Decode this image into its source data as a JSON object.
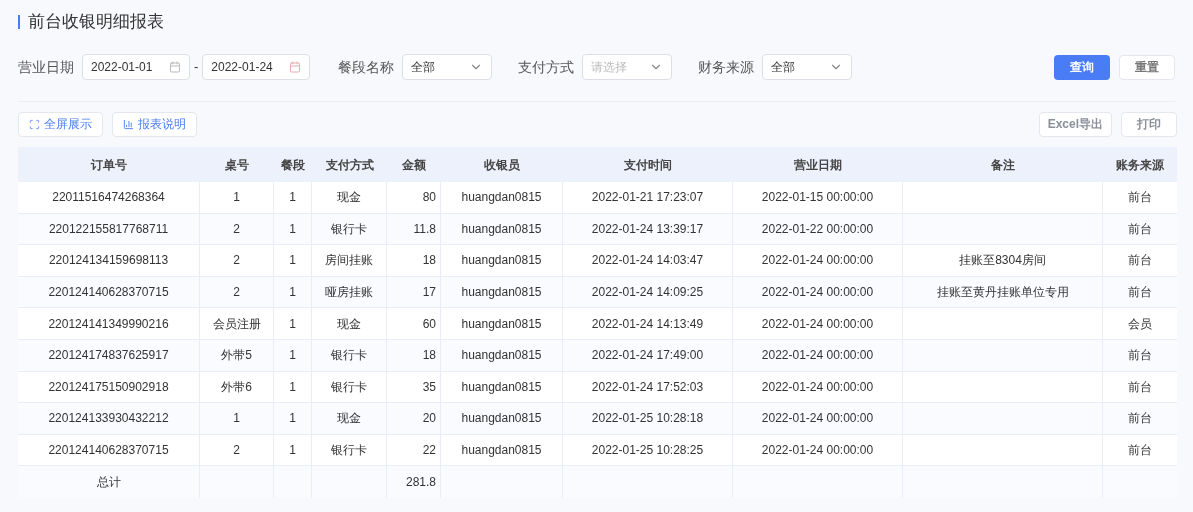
{
  "title": "前台收银明细报表",
  "filters": [
    {
      "kind": "daterange",
      "label": "营业日期",
      "start": "2022-01-01",
      "separator": "-",
      "end": "2022-01-24"
    },
    {
      "kind": "select",
      "label": "餐段名称",
      "value": "全部"
    },
    {
      "kind": "select",
      "label": "支付方式",
      "placeholder": "请选择"
    },
    {
      "kind": "select",
      "label": "财务来源",
      "value": "全部"
    }
  ],
  "actions": [
    {
      "label": "查询",
      "primary": true
    },
    {
      "label": "重置",
      "primary": false
    }
  ],
  "toolbar_left": [
    {
      "label": "全屏展示",
      "kind": "fullscreen"
    },
    {
      "label": "报表说明",
      "kind": "chart"
    }
  ],
  "toolbar_right": [
    {
      "label": "Excel导出"
    },
    {
      "label": "打印"
    }
  ],
  "table": {
    "columns": [
      "订单号",
      "桌号",
      "餐段",
      "支付方式",
      "金额",
      "收银员",
      "支付时间",
      "营业日期",
      "备注",
      "账务来源"
    ],
    "rows": [
      [
        "22011516474268364",
        "1",
        "1",
        "现金",
        "80",
        "huangdan0815",
        "2022-01-21 17:23:07",
        "2022-01-15 00:00:00",
        null,
        "前台"
      ],
      [
        "220122155817768711",
        "2",
        "1",
        "银行卡",
        "11.8",
        "huangdan0815",
        "2022-01-24 13:39:17",
        "2022-01-22 00:00:00",
        null,
        "前台"
      ],
      [
        "220124134159698113",
        "2",
        "1",
        "房间挂账",
        "18",
        "huangdan0815",
        "2022-01-24 14:03:47",
        "2022-01-24 00:00:00",
        "挂账至8304房间",
        "前台"
      ],
      [
        "220124140628370715",
        "2",
        "1",
        "哑房挂账",
        "17",
        "huangdan0815",
        "2022-01-24 14:09:25",
        "2022-01-24 00:00:00",
        "挂账至黄丹挂账单位专用",
        "前台"
      ],
      [
        "220124141349990216",
        "会员注册",
        "1",
        "现金",
        "60",
        "huangdan0815",
        "2022-01-24 14:13:49",
        "2022-01-24 00:00:00",
        null,
        "会员"
      ],
      [
        "220124174837625917",
        "外带5",
        "1",
        "银行卡",
        "18",
        "huangdan0815",
        "2022-01-24 17:49:00",
        "2022-01-24 00:00:00",
        null,
        "前台"
      ],
      [
        "220124175150902918",
        "外带6",
        "1",
        "银行卡",
        "35",
        "huangdan0815",
        "2022-01-24 17:52:03",
        "2022-01-24 00:00:00",
        null,
        "前台"
      ],
      [
        "220124133930432212",
        "1",
        "1",
        "现金",
        "20",
        "huangdan0815",
        "2022-01-25 10:28:18",
        "2022-01-24 00:00:00",
        null,
        "前台"
      ],
      [
        "220124140628370715",
        "2",
        "1",
        "银行卡",
        "22",
        "huangdan0815",
        "2022-01-25 10:28:25",
        "2022-01-24 00:00:00",
        null,
        "前台"
      ]
    ],
    "total": {
      "label": "总计",
      "amount": "281.8"
    }
  }
}
